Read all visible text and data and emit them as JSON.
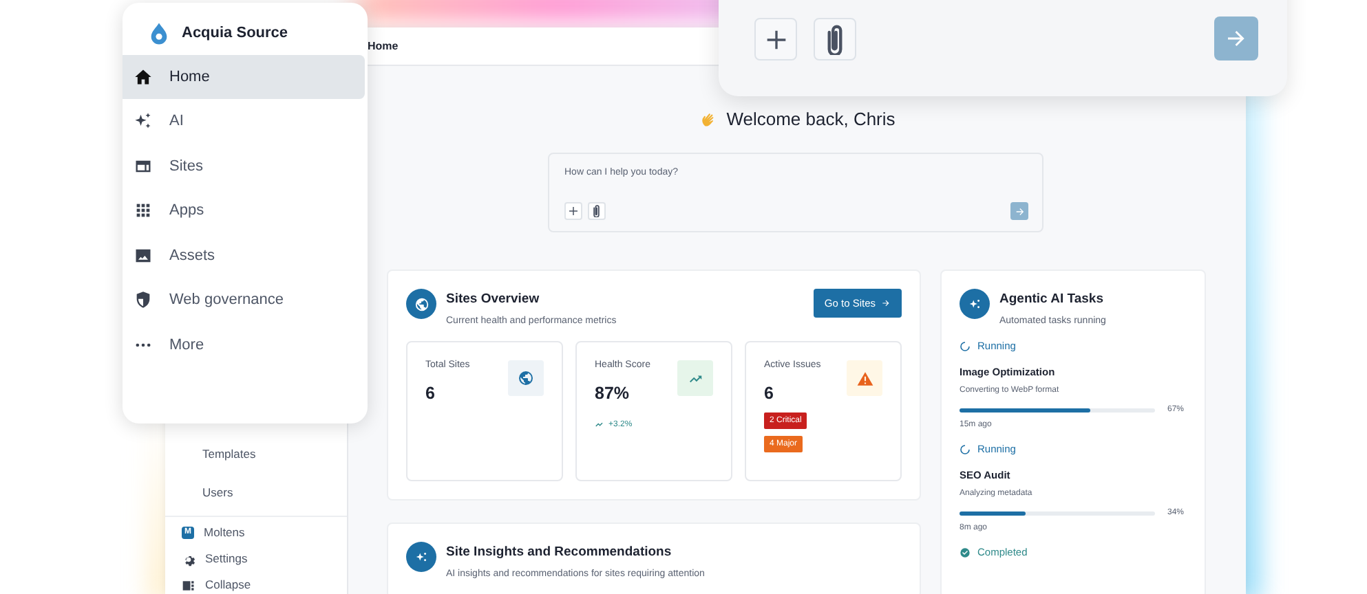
{
  "menu": {
    "brand": "Acquia Source",
    "items": [
      {
        "label": "Home",
        "kind": "home",
        "selected": true
      },
      {
        "label": "AI",
        "kind": "ai",
        "selected": false
      },
      {
        "label": "Sites",
        "kind": "sites",
        "selected": false
      },
      {
        "label": "Apps",
        "kind": "apps",
        "selected": false
      },
      {
        "label": "Assets",
        "kind": "assets",
        "selected": false
      },
      {
        "label": "Web governance",
        "kind": "governance",
        "selected": false
      },
      {
        "label": "More",
        "kind": "more",
        "selected": false
      }
    ]
  },
  "sidebar": {
    "items": [
      {
        "label": "Templates"
      },
      {
        "label": "Users"
      }
    ],
    "footer": [
      {
        "label": "Moltens",
        "kind": "workspace",
        "badge": "M"
      },
      {
        "label": "Settings",
        "kind": "settings"
      },
      {
        "label": "Collapse",
        "kind": "collapse"
      }
    ]
  },
  "breadcrumb": "Home",
  "greeting": "Welcome back, Chris",
  "prompt": {
    "placeholder": "How can I help you today?"
  },
  "sites_overview": {
    "title": "Sites Overview",
    "subtitle": "Current health and performance metrics",
    "button": "Go to Sites",
    "metrics": [
      {
        "label": "Total Sites",
        "value": "6",
        "kind": "sites"
      },
      {
        "label": "Health Score",
        "value": "87%",
        "kind": "health",
        "trend": "+3.2%"
      },
      {
        "label": "Active Issues",
        "value": "6",
        "kind": "issues",
        "tags": [
          {
            "text": "2 Critical",
            "color": "#c8201e"
          },
          {
            "text": "4 Major",
            "color": "#ea6a1e"
          }
        ]
      }
    ]
  },
  "insights": {
    "title": "Site Insights and Recommendations",
    "subtitle": "AI insights and recommendations for sites requiring attention"
  },
  "agentic_tasks": {
    "title": "Agentic AI Tasks",
    "subtitle": "Automated tasks running",
    "tasks": [
      {
        "kind": "running",
        "status_label": "Running",
        "name": "Image Optimization",
        "detail": "Converting to WebP format",
        "level": 0.67,
        "percent": "67%",
        "time": "15m ago"
      },
      {
        "kind": "running",
        "status_label": "Running",
        "name": "SEO Audit",
        "detail": "Analyzing metadata",
        "level": 0.34,
        "percent": "34%",
        "time": "8m ago"
      },
      {
        "kind": "completed",
        "status_label": "Completed"
      }
    ]
  }
}
